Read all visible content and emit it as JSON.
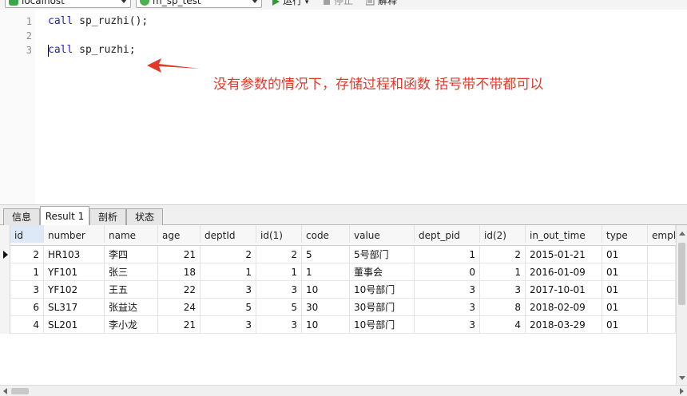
{
  "toolbar": {
    "connection": "localhost",
    "database": "m_sp_test",
    "run_label": "运行",
    "stop_label": "停止",
    "explain_label": "解释"
  },
  "editor": {
    "line_numbers": [
      "1",
      "2",
      "3"
    ],
    "line1_kw": "call",
    "line1_rest": " sp_ruzhi();",
    "line3_kw": "call",
    "line3_rest": " sp_ruzhi;",
    "annotation": "没有参数的情况下，存储过程和函数 括号带不带都可以",
    "annotation_color": "#e03a2b"
  },
  "tabs": [
    "信息",
    "Result 1",
    "剖析",
    "状态"
  ],
  "grid": {
    "columns": [
      "id",
      "number",
      "name",
      "age",
      "deptId",
      "id(1)",
      "code",
      "value",
      "dept_pid",
      "id(2)",
      "in_out_time",
      "type",
      "empl"
    ],
    "rows": [
      [
        "2",
        "HR103",
        "李四",
        "21",
        "2",
        "2",
        "5",
        "5号部门",
        "1",
        "2",
        "2015-01-21",
        "01",
        ""
      ],
      [
        "1",
        "YF101",
        "张三",
        "18",
        "1",
        "1",
        "1",
        "董事会",
        "0",
        "1",
        "2016-01-09",
        "01",
        ""
      ],
      [
        "3",
        "YF102",
        "王五",
        "22",
        "3",
        "3",
        "10",
        "10号部门",
        "3",
        "3",
        "2017-10-01",
        "01",
        ""
      ],
      [
        "6",
        "SL317",
        "张益达",
        "24",
        "5",
        "5",
        "30",
        "30号部门",
        "3",
        "8",
        "2018-02-09",
        "01",
        ""
      ],
      [
        "4",
        "SL201",
        "李小龙",
        "21",
        "3",
        "3",
        "10",
        "10号部门",
        "3",
        "4",
        "2018-03-29",
        "01",
        ""
      ]
    ]
  }
}
